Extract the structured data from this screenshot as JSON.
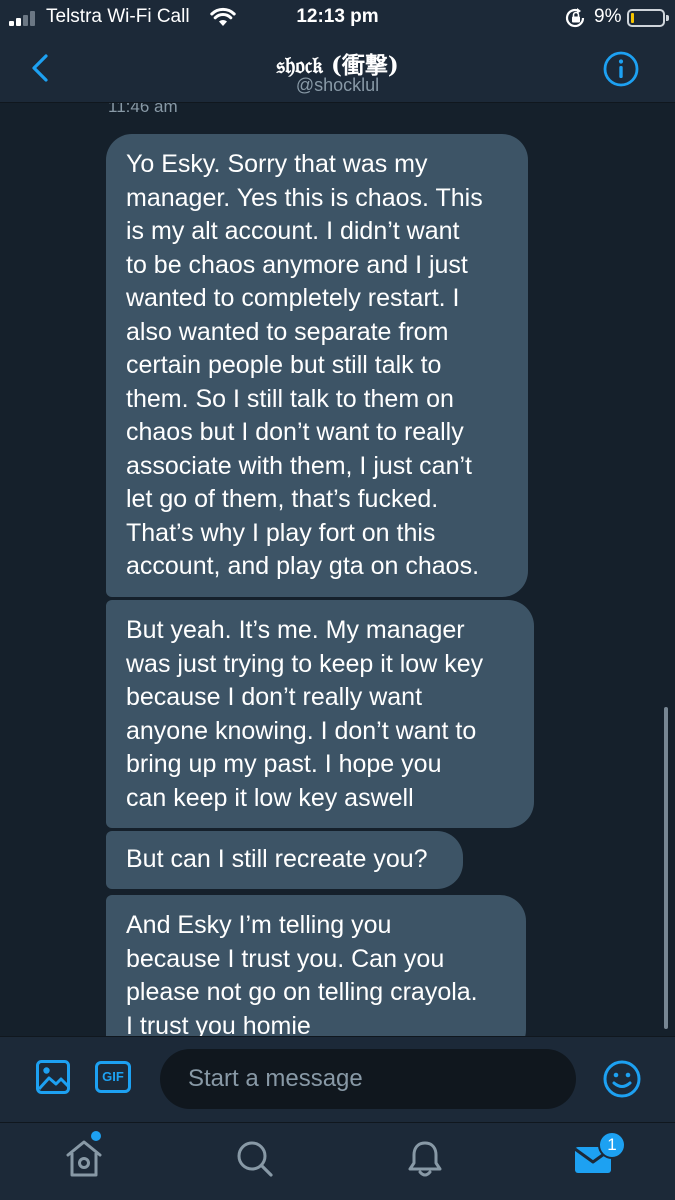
{
  "status_bar": {
    "carrier": "Telstra Wi-Fi Call",
    "time": "12:13 pm",
    "battery_percent": "9%",
    "battery_level": 0.09,
    "signal_bars": 2
  },
  "header": {
    "title": "𝔰𝔥𝔬𝔠𝔨 (衝撃)",
    "handle": "@shocklul"
  },
  "conversation": {
    "cut_timestamp": "11:46 am",
    "messages": [
      {
        "lines": [
          "Yo Esky. Sorry that was my",
          "manager. Yes this is chaos. This",
          "is my alt account. I didn’t want",
          "to be chaos anymore and I just",
          "wanted to completely restart. I",
          "also wanted to separate from",
          "certain people but still talk to",
          "them. So I still talk to them on",
          "chaos but I don’t want to really",
          "associate with them, I just can’t",
          "let go of them, that’s fucked.",
          "That’s why I play fort on this",
          "account, and play gta on chaos."
        ]
      },
      {
        "lines": [
          "But yeah. It’s me. My manager",
          "was just trying to keep it low key",
          "because I don’t really want",
          "anyone knowing. I don’t want to",
          "bring up my past. I hope you",
          "can keep it low key aswell"
        ]
      },
      {
        "lines": [
          "But can I still recreate you?"
        ]
      },
      {
        "lines": [
          "And Esky I’m telling you",
          "because I trust you. Can you",
          "please not go on telling crayola.",
          "I trust you homie"
        ]
      }
    ]
  },
  "composer": {
    "placeholder": "Start a message",
    "gif_label": "GIF"
  },
  "tabbar": {
    "messages_badge": "1"
  },
  "colors": {
    "background": "#15202b",
    "header": "#1c2938",
    "bubble": "#3d5466",
    "accent": "#1da1f2",
    "muted": "#8899a6"
  },
  "icons": {
    "back": "chevron-left-icon",
    "info": "info-icon",
    "media": "image-icon",
    "emoji": "smiley-icon",
    "home": "home-icon",
    "search": "search-icon",
    "notifications": "bell-icon",
    "messages": "envelope-icon"
  }
}
